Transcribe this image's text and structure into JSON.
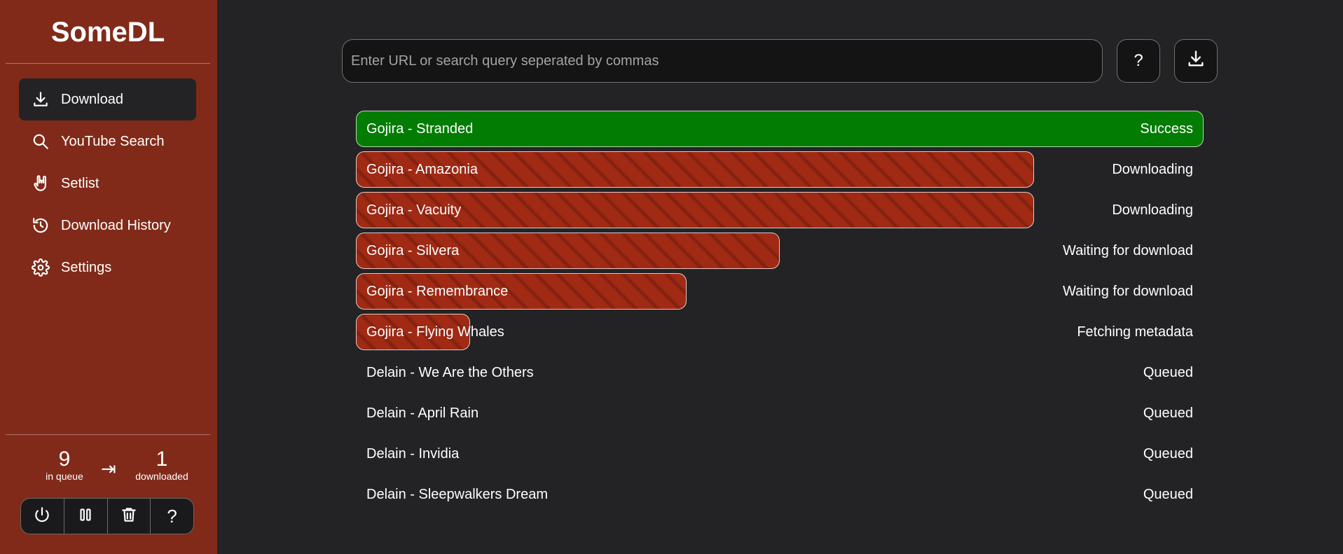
{
  "app": {
    "title": "SomeDL"
  },
  "sidebar": {
    "items": [
      {
        "label": "Download",
        "icon": "download-icon",
        "active": true
      },
      {
        "label": "YouTube Search",
        "icon": "search-icon",
        "active": false
      },
      {
        "label": "Setlist",
        "icon": "rock-hand-icon",
        "active": false
      },
      {
        "label": "Download History",
        "icon": "history-icon",
        "active": false
      },
      {
        "label": "Settings",
        "icon": "gear-icon",
        "active": false
      }
    ],
    "stats": {
      "queue_count": "9",
      "queue_label": "in queue",
      "arrow": "⇥",
      "downloaded_count": "1",
      "downloaded_label": "downloaded"
    },
    "controls": [
      {
        "icon": "power-icon"
      },
      {
        "icon": "pause-icon"
      },
      {
        "icon": "trash-icon"
      },
      {
        "icon": "help-icon",
        "label": "?"
      }
    ]
  },
  "search": {
    "placeholder": "Enter URL or search query seperated by commas",
    "value": "",
    "help_label": "?"
  },
  "colors": {
    "sidebar_bg": "#812a19",
    "main_bg": "#232325",
    "progress_red": "#a02a14",
    "success_green": "#037c03"
  },
  "queue": [
    {
      "title": "Gojira - Stranded",
      "status": "Success",
      "progress": 1.0,
      "state": "success"
    },
    {
      "title": "Gojira - Amazonia",
      "status": "Downloading",
      "progress": 0.8,
      "state": "progress"
    },
    {
      "title": "Gojira - Vacuity",
      "status": "Downloading",
      "progress": 0.8,
      "state": "progress"
    },
    {
      "title": "Gojira - Silvera",
      "status": "Waiting for download",
      "progress": 0.5,
      "state": "progress"
    },
    {
      "title": "Gojira - Remembrance",
      "status": "Waiting for download",
      "progress": 0.39,
      "state": "progress"
    },
    {
      "title": "Gojira - Flying Whales",
      "status": "Fetching metadata",
      "progress": 0.135,
      "state": "progress"
    },
    {
      "title": "Delain - We Are the Others",
      "status": "Queued",
      "progress": 0,
      "state": "queued"
    },
    {
      "title": "Delain - April Rain",
      "status": "Queued",
      "progress": 0,
      "state": "queued"
    },
    {
      "title": "Delain - Invidia",
      "status": "Queued",
      "progress": 0,
      "state": "queued"
    },
    {
      "title": "Delain - Sleepwalkers Dream",
      "status": "Queued",
      "progress": 0,
      "state": "queued"
    }
  ]
}
